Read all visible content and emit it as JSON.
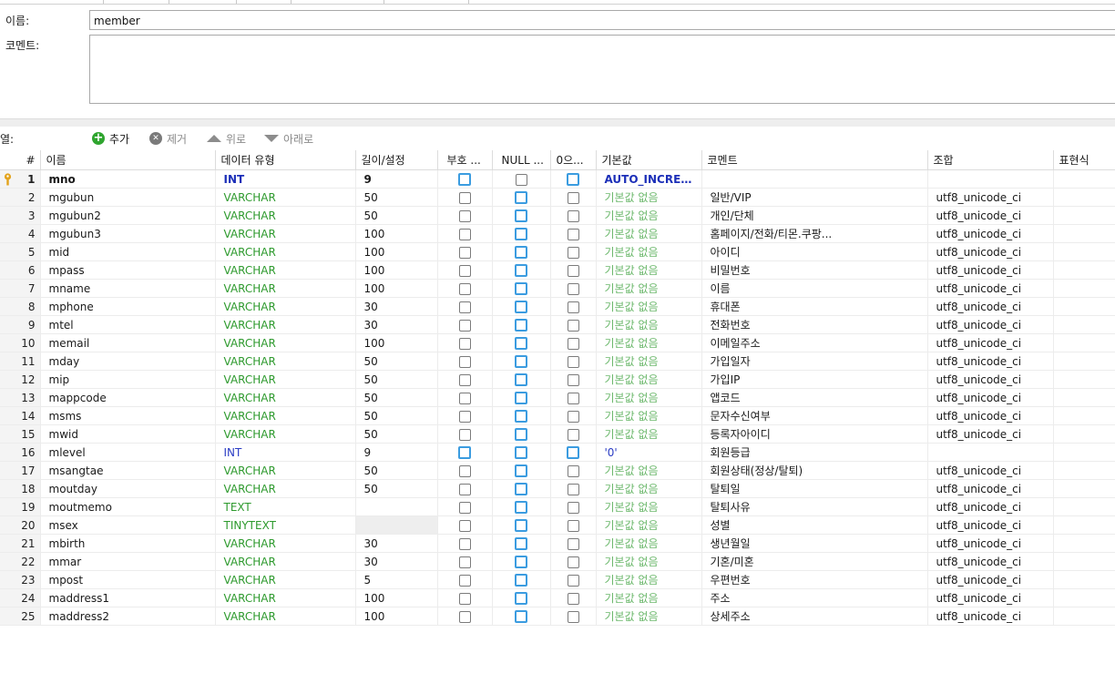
{
  "form": {
    "name_label": "이름:",
    "name_value": "member",
    "comment_label": "코멘트:",
    "comment_value": ""
  },
  "toolbar": {
    "columns_label": "열:",
    "add_label": "추가",
    "remove_label": "제거",
    "up_label": "위로",
    "down_label": "아래로"
  },
  "grid": {
    "headers": [
      "#",
      "이름",
      "데이터 유형",
      "길이/설정",
      "부호 ...",
      "NULL ...",
      "0으...",
      "기본값",
      "코멘트",
      "조합",
      "표현식"
    ],
    "rows": [
      {
        "n": "1",
        "name": "mno",
        "type": "INT",
        "len": "9",
        "unsigned": true,
        "nullable": false,
        "zerofill": true,
        "def": "AUTO_INCREME...",
        "comment": "",
        "collation": "",
        "pk": true
      },
      {
        "n": "2",
        "name": "mgubun",
        "type": "VARCHAR",
        "len": "50",
        "unsigned": false,
        "nullable": true,
        "zerofill": false,
        "def": "기본값 없음",
        "comment": "일반/VIP",
        "collation": "utf8_unicode_ci"
      },
      {
        "n": "3",
        "name": "mgubun2",
        "type": "VARCHAR",
        "len": "50",
        "unsigned": false,
        "nullable": true,
        "zerofill": false,
        "def": "기본값 없음",
        "comment": "개인/단체",
        "collation": "utf8_unicode_ci"
      },
      {
        "n": "4",
        "name": "mgubun3",
        "type": "VARCHAR",
        "len": "100",
        "unsigned": false,
        "nullable": true,
        "zerofill": false,
        "def": "기본값 없음",
        "comment": "홈페이지/전화/티몬.쿠팡...",
        "collation": "utf8_unicode_ci"
      },
      {
        "n": "5",
        "name": "mid",
        "type": "VARCHAR",
        "len": "100",
        "unsigned": false,
        "nullable": true,
        "zerofill": false,
        "def": "기본값 없음",
        "comment": "아이디",
        "collation": "utf8_unicode_ci"
      },
      {
        "n": "6",
        "name": "mpass",
        "type": "VARCHAR",
        "len": "100",
        "unsigned": false,
        "nullable": true,
        "zerofill": false,
        "def": "기본값 없음",
        "comment": "비밀번호",
        "collation": "utf8_unicode_ci"
      },
      {
        "n": "7",
        "name": "mname",
        "type": "VARCHAR",
        "len": "100",
        "unsigned": false,
        "nullable": true,
        "zerofill": false,
        "def": "기본값 없음",
        "comment": "이름",
        "collation": "utf8_unicode_ci"
      },
      {
        "n": "8",
        "name": "mphone",
        "type": "VARCHAR",
        "len": "30",
        "unsigned": false,
        "nullable": true,
        "zerofill": false,
        "def": "기본값 없음",
        "comment": "휴대폰",
        "collation": "utf8_unicode_ci"
      },
      {
        "n": "9",
        "name": "mtel",
        "type": "VARCHAR",
        "len": "30",
        "unsigned": false,
        "nullable": true,
        "zerofill": false,
        "def": "기본값 없음",
        "comment": "전화번호",
        "collation": "utf8_unicode_ci"
      },
      {
        "n": "10",
        "name": "memail",
        "type": "VARCHAR",
        "len": "100",
        "unsigned": false,
        "nullable": true,
        "zerofill": false,
        "def": "기본값 없음",
        "comment": "이메일주소",
        "collation": "utf8_unicode_ci"
      },
      {
        "n": "11",
        "name": "mday",
        "type": "VARCHAR",
        "len": "50",
        "unsigned": false,
        "nullable": true,
        "zerofill": false,
        "def": "기본값 없음",
        "comment": "가입일자",
        "collation": "utf8_unicode_ci"
      },
      {
        "n": "12",
        "name": "mip",
        "type": "VARCHAR",
        "len": "50",
        "unsigned": false,
        "nullable": true,
        "zerofill": false,
        "def": "기본값 없음",
        "comment": "가입IP",
        "collation": "utf8_unicode_ci"
      },
      {
        "n": "13",
        "name": "mappcode",
        "type": "VARCHAR",
        "len": "50",
        "unsigned": false,
        "nullable": true,
        "zerofill": false,
        "def": "기본값 없음",
        "comment": "앱코드",
        "collation": "utf8_unicode_ci"
      },
      {
        "n": "14",
        "name": "msms",
        "type": "VARCHAR",
        "len": "50",
        "unsigned": false,
        "nullable": true,
        "zerofill": false,
        "def": "기본값 없음",
        "comment": "문자수신여부",
        "collation": "utf8_unicode_ci"
      },
      {
        "n": "15",
        "name": "mwid",
        "type": "VARCHAR",
        "len": "50",
        "unsigned": false,
        "nullable": true,
        "zerofill": false,
        "def": "기본값 없음",
        "comment": "등록자아이디",
        "collation": "utf8_unicode_ci"
      },
      {
        "n": "16",
        "name": "mlevel",
        "type": "INT",
        "len": "9",
        "unsigned": true,
        "nullable": true,
        "zerofill": true,
        "def": "'0'",
        "comment": "회원등급",
        "collation": ""
      },
      {
        "n": "17",
        "name": "msangtae",
        "type": "VARCHAR",
        "len": "50",
        "unsigned": false,
        "nullable": true,
        "zerofill": false,
        "def": "기본값 없음",
        "comment": "회원상태(정상/탈퇴)",
        "collation": "utf8_unicode_ci"
      },
      {
        "n": "18",
        "name": "moutday",
        "type": "VARCHAR",
        "len": "50",
        "unsigned": false,
        "nullable": true,
        "zerofill": false,
        "def": "기본값 없음",
        "comment": "탈퇴일",
        "collation": "utf8_unicode_ci"
      },
      {
        "n": "19",
        "name": "moutmemo",
        "type": "TEXT",
        "len": "",
        "unsigned": false,
        "nullable": true,
        "zerofill": false,
        "def": "기본값 없음",
        "comment": "탈퇴사유",
        "collation": "utf8_unicode_ci"
      },
      {
        "n": "20",
        "name": "msex",
        "type": "TINYTEXT",
        "len": "",
        "unsigned": false,
        "nullable": true,
        "zerofill": false,
        "def": "기본값 없음",
        "comment": "성별",
        "collation": "utf8_unicode_ci",
        "len_disabled": true
      },
      {
        "n": "21",
        "name": "mbirth",
        "type": "VARCHAR",
        "len": "30",
        "unsigned": false,
        "nullable": true,
        "zerofill": false,
        "def": "기본값 없음",
        "comment": "생년월일",
        "collation": "utf8_unicode_ci"
      },
      {
        "n": "22",
        "name": "mmar",
        "type": "VARCHAR",
        "len": "30",
        "unsigned": false,
        "nullable": true,
        "zerofill": false,
        "def": "기본값 없음",
        "comment": "기혼/미혼",
        "collation": "utf8_unicode_ci"
      },
      {
        "n": "23",
        "name": "mpost",
        "type": "VARCHAR",
        "len": "5",
        "unsigned": false,
        "nullable": true,
        "zerofill": false,
        "def": "기본값 없음",
        "comment": "우편번호",
        "collation": "utf8_unicode_ci"
      },
      {
        "n": "24",
        "name": "maddress1",
        "type": "VARCHAR",
        "len": "100",
        "unsigned": false,
        "nullable": true,
        "zerofill": false,
        "def": "기본값 없음",
        "comment": "주소",
        "collation": "utf8_unicode_ci"
      },
      {
        "n": "25",
        "name": "maddress2",
        "type": "VARCHAR",
        "len": "100",
        "unsigned": false,
        "nullable": true,
        "zerofill": false,
        "def": "기본값 없음",
        "comment": "상세주소",
        "collation": "utf8_unicode_ci"
      }
    ]
  },
  "colors": {
    "type_varchar": "#2e9a2e",
    "type_int": "#2a3cc4",
    "default_none": "#6cb86c",
    "checkbox_checked_border": "#3b9ce0",
    "primary_key_icon": "#e3a31c"
  }
}
